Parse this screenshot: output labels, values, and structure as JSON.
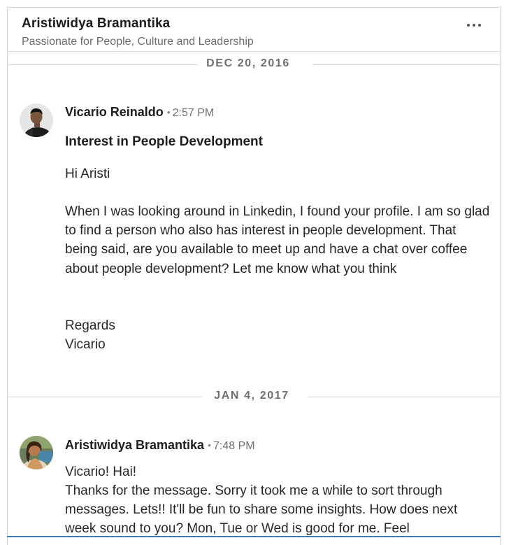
{
  "header": {
    "name": "Aristiwidya Bramantika",
    "headline": "Passionate for People, Culture and Leadership",
    "more_icon": "more-horizontal-icon"
  },
  "dividers": [
    {
      "label": "DEC 20, 2016"
    },
    {
      "label": "JAN 4, 2017"
    }
  ],
  "messages": [
    {
      "sender": "Vicario Reinaldo",
      "time": "2:57 PM",
      "subject": "Interest in People Development",
      "greeting": "Hi Aristi",
      "body": "When I was looking around in Linkedin, I found your profile. I am so glad to find a person who also has interest in people development. That being said, are you available to meet up and have a chat over coffee about people development? Let me know what you think",
      "sign_1": "Regards",
      "sign_2": "Vicario"
    },
    {
      "sender": "Aristiwidya Bramantika",
      "time": "7:48 PM",
      "line_1": "Vicario! Hai!",
      "body": "Thanks for the message. Sorry it took me a while to sort through messages. Lets!! It'll be fun to share some insights. How does next week sound to you? Mon, Tue or Wed is good for me. Feel"
    }
  ],
  "colors": {
    "divider": "#d9d9d9",
    "muted_text": "#6f6f6f",
    "accent_bottom": "#3d7bb5"
  }
}
